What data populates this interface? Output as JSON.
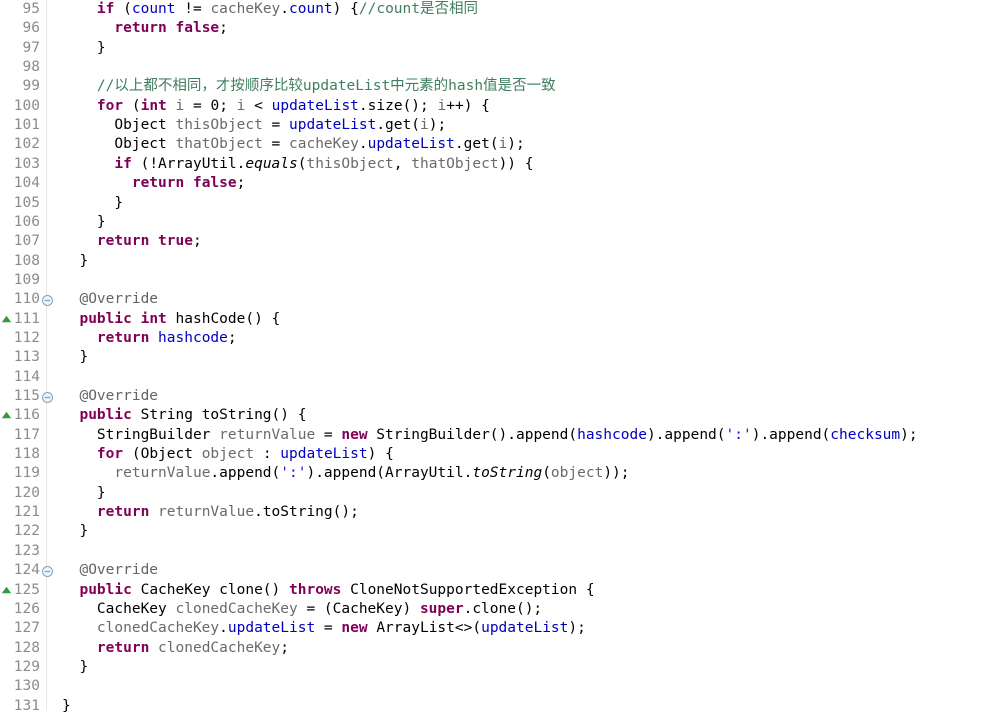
{
  "editor": {
    "language": "java",
    "theme": "eclipse-light",
    "background_color": "#ffffff",
    "gutter_separator_color": "#e8e8e8",
    "line_number_color": "#8c8c8c",
    "first_line": 95,
    "last_line": 131,
    "colors": {
      "keyword": "#7f0055",
      "comment": "#3f7f5f",
      "string": "#2a00ff",
      "field": "#0000c0",
      "annotation": "#646464",
      "local_variable": "#6a6a6a",
      "plain": "#000000",
      "override_marker": "#2e9b3f",
      "fold_icon": "#7aa7c7"
    },
    "icons": {
      "override_marker": "override-triangle-icon",
      "fold_collapse": "fold-collapse-icon"
    }
  },
  "lines": [
    {
      "number": "95",
      "marker": null,
      "fold": false,
      "tokens": [
        {
          "t": "    ",
          "c": "pln"
        },
        {
          "t": "if",
          "c": "kw"
        },
        {
          "t": " (",
          "c": "pln"
        },
        {
          "t": "count",
          "c": "fld"
        },
        {
          "t": " != ",
          "c": "pln"
        },
        {
          "t": "cacheKey",
          "c": "lvar"
        },
        {
          "t": ".",
          "c": "pln"
        },
        {
          "t": "count",
          "c": "fld"
        },
        {
          "t": ") {",
          "c": "pln"
        },
        {
          "t": "//count是否相同",
          "c": "cm"
        }
      ]
    },
    {
      "number": "96",
      "marker": null,
      "fold": false,
      "tokens": [
        {
          "t": "      ",
          "c": "pln"
        },
        {
          "t": "return",
          "c": "kw"
        },
        {
          "t": " ",
          "c": "pln"
        },
        {
          "t": "false",
          "c": "kw"
        },
        {
          "t": ";",
          "c": "pln"
        }
      ]
    },
    {
      "number": "97",
      "marker": null,
      "fold": false,
      "tokens": [
        {
          "t": "    }",
          "c": "pln"
        }
      ]
    },
    {
      "number": "98",
      "marker": null,
      "fold": false,
      "tokens": []
    },
    {
      "number": "99",
      "marker": null,
      "fold": false,
      "tokens": [
        {
          "t": "    ",
          "c": "pln"
        },
        {
          "t": "//以上都不相同，才按顺序比较updateList中元素的hash值是否一致",
          "c": "cm"
        }
      ]
    },
    {
      "number": "100",
      "marker": null,
      "fold": false,
      "tokens": [
        {
          "t": "    ",
          "c": "pln"
        },
        {
          "t": "for",
          "c": "kw"
        },
        {
          "t": " (",
          "c": "pln"
        },
        {
          "t": "int",
          "c": "kw"
        },
        {
          "t": " ",
          "c": "pln"
        },
        {
          "t": "i",
          "c": "lvar"
        },
        {
          "t": " = ",
          "c": "pln"
        },
        {
          "t": "0",
          "c": "num"
        },
        {
          "t": "; ",
          "c": "pln"
        },
        {
          "t": "i",
          "c": "lvar"
        },
        {
          "t": " < ",
          "c": "pln"
        },
        {
          "t": "updateList",
          "c": "fld"
        },
        {
          "t": ".size(); ",
          "c": "pln"
        },
        {
          "t": "i",
          "c": "lvar"
        },
        {
          "t": "++) {",
          "c": "pln"
        }
      ]
    },
    {
      "number": "101",
      "marker": null,
      "fold": false,
      "tokens": [
        {
          "t": "      Object ",
          "c": "pln"
        },
        {
          "t": "thisObject",
          "c": "lvar"
        },
        {
          "t": " = ",
          "c": "pln"
        },
        {
          "t": "updateList",
          "c": "fld"
        },
        {
          "t": ".get(",
          "c": "pln"
        },
        {
          "t": "i",
          "c": "lvar"
        },
        {
          "t": ");",
          "c": "pln"
        }
      ]
    },
    {
      "number": "102",
      "marker": null,
      "fold": false,
      "tokens": [
        {
          "t": "      Object ",
          "c": "pln"
        },
        {
          "t": "thatObject",
          "c": "lvar"
        },
        {
          "t": " = ",
          "c": "pln"
        },
        {
          "t": "cacheKey",
          "c": "lvar"
        },
        {
          "t": ".",
          "c": "pln"
        },
        {
          "t": "updateList",
          "c": "fld"
        },
        {
          "t": ".get(",
          "c": "pln"
        },
        {
          "t": "i",
          "c": "lvar"
        },
        {
          "t": ");",
          "c": "pln"
        }
      ]
    },
    {
      "number": "103",
      "marker": null,
      "fold": false,
      "tokens": [
        {
          "t": "      ",
          "c": "pln"
        },
        {
          "t": "if",
          "c": "kw"
        },
        {
          "t": " (!ArrayUtil.",
          "c": "pln"
        },
        {
          "t": "equals",
          "c": "stat"
        },
        {
          "t": "(",
          "c": "pln"
        },
        {
          "t": "thisObject",
          "c": "lvar"
        },
        {
          "t": ", ",
          "c": "pln"
        },
        {
          "t": "thatObject",
          "c": "lvar"
        },
        {
          "t": ")) {",
          "c": "pln"
        }
      ]
    },
    {
      "number": "104",
      "marker": null,
      "fold": false,
      "tokens": [
        {
          "t": "        ",
          "c": "pln"
        },
        {
          "t": "return",
          "c": "kw"
        },
        {
          "t": " ",
          "c": "pln"
        },
        {
          "t": "false",
          "c": "kw"
        },
        {
          "t": ";",
          "c": "pln"
        }
      ]
    },
    {
      "number": "105",
      "marker": null,
      "fold": false,
      "tokens": [
        {
          "t": "      }",
          "c": "pln"
        }
      ]
    },
    {
      "number": "106",
      "marker": null,
      "fold": false,
      "tokens": [
        {
          "t": "    }",
          "c": "pln"
        }
      ]
    },
    {
      "number": "107",
      "marker": null,
      "fold": false,
      "tokens": [
        {
          "t": "    ",
          "c": "pln"
        },
        {
          "t": "return",
          "c": "kw"
        },
        {
          "t": " ",
          "c": "pln"
        },
        {
          "t": "true",
          "c": "kw"
        },
        {
          "t": ";",
          "c": "pln"
        }
      ]
    },
    {
      "number": "108",
      "marker": null,
      "fold": false,
      "tokens": [
        {
          "t": "  }",
          "c": "pln"
        }
      ]
    },
    {
      "number": "109",
      "marker": null,
      "fold": false,
      "tokens": []
    },
    {
      "number": "110",
      "marker": null,
      "fold": true,
      "tokens": [
        {
          "t": "  ",
          "c": "pln"
        },
        {
          "t": "@Override",
          "c": "ann"
        }
      ]
    },
    {
      "number": "111",
      "marker": "override",
      "fold": false,
      "tokens": [
        {
          "t": "  ",
          "c": "pln"
        },
        {
          "t": "public",
          "c": "kw"
        },
        {
          "t": " ",
          "c": "pln"
        },
        {
          "t": "int",
          "c": "kw"
        },
        {
          "t": " hashCode() {",
          "c": "pln"
        }
      ]
    },
    {
      "number": "112",
      "marker": null,
      "fold": false,
      "tokens": [
        {
          "t": "    ",
          "c": "pln"
        },
        {
          "t": "return",
          "c": "kw"
        },
        {
          "t": " ",
          "c": "pln"
        },
        {
          "t": "hashcode",
          "c": "fld"
        },
        {
          "t": ";",
          "c": "pln"
        }
      ]
    },
    {
      "number": "113",
      "marker": null,
      "fold": false,
      "tokens": [
        {
          "t": "  }",
          "c": "pln"
        }
      ]
    },
    {
      "number": "114",
      "marker": null,
      "fold": false,
      "tokens": []
    },
    {
      "number": "115",
      "marker": null,
      "fold": true,
      "tokens": [
        {
          "t": "  ",
          "c": "pln"
        },
        {
          "t": "@Override",
          "c": "ann"
        }
      ]
    },
    {
      "number": "116",
      "marker": "override",
      "fold": false,
      "tokens": [
        {
          "t": "  ",
          "c": "pln"
        },
        {
          "t": "public",
          "c": "kw"
        },
        {
          "t": " String toString() {",
          "c": "pln"
        }
      ]
    },
    {
      "number": "117",
      "marker": null,
      "fold": false,
      "tokens": [
        {
          "t": "    StringBuilder ",
          "c": "pln"
        },
        {
          "t": "returnValue",
          "c": "lvar"
        },
        {
          "t": " = ",
          "c": "pln"
        },
        {
          "t": "new",
          "c": "kw"
        },
        {
          "t": " StringBuilder().append(",
          "c": "pln"
        },
        {
          "t": "hashcode",
          "c": "fld"
        },
        {
          "t": ").append(",
          "c": "pln"
        },
        {
          "t": "':'",
          "c": "str"
        },
        {
          "t": ").append(",
          "c": "pln"
        },
        {
          "t": "checksum",
          "c": "fld"
        },
        {
          "t": ");",
          "c": "pln"
        }
      ]
    },
    {
      "number": "118",
      "marker": null,
      "fold": false,
      "tokens": [
        {
          "t": "    ",
          "c": "pln"
        },
        {
          "t": "for",
          "c": "kw"
        },
        {
          "t": " (Object ",
          "c": "pln"
        },
        {
          "t": "object",
          "c": "lvar"
        },
        {
          "t": " : ",
          "c": "pln"
        },
        {
          "t": "updateList",
          "c": "fld"
        },
        {
          "t": ") {",
          "c": "pln"
        }
      ]
    },
    {
      "number": "119",
      "marker": null,
      "fold": false,
      "tokens": [
        {
          "t": "      ",
          "c": "pln"
        },
        {
          "t": "returnValue",
          "c": "lvar"
        },
        {
          "t": ".append(",
          "c": "pln"
        },
        {
          "t": "':'",
          "c": "str"
        },
        {
          "t": ").append(ArrayUtil.",
          "c": "pln"
        },
        {
          "t": "toString",
          "c": "stat"
        },
        {
          "t": "(",
          "c": "pln"
        },
        {
          "t": "object",
          "c": "lvar"
        },
        {
          "t": "));",
          "c": "pln"
        }
      ]
    },
    {
      "number": "120",
      "marker": null,
      "fold": false,
      "tokens": [
        {
          "t": "    }",
          "c": "pln"
        }
      ]
    },
    {
      "number": "121",
      "marker": null,
      "fold": false,
      "tokens": [
        {
          "t": "    ",
          "c": "pln"
        },
        {
          "t": "return",
          "c": "kw"
        },
        {
          "t": " ",
          "c": "pln"
        },
        {
          "t": "returnValue",
          "c": "lvar"
        },
        {
          "t": ".toString();",
          "c": "pln"
        }
      ]
    },
    {
      "number": "122",
      "marker": null,
      "fold": false,
      "tokens": [
        {
          "t": "  }",
          "c": "pln"
        }
      ]
    },
    {
      "number": "123",
      "marker": null,
      "fold": false,
      "tokens": []
    },
    {
      "number": "124",
      "marker": null,
      "fold": true,
      "tokens": [
        {
          "t": "  ",
          "c": "pln"
        },
        {
          "t": "@Override",
          "c": "ann"
        }
      ]
    },
    {
      "number": "125",
      "marker": "override",
      "fold": false,
      "tokens": [
        {
          "t": "  ",
          "c": "pln"
        },
        {
          "t": "public",
          "c": "kw"
        },
        {
          "t": " CacheKey clone() ",
          "c": "pln"
        },
        {
          "t": "throws",
          "c": "kw"
        },
        {
          "t": " CloneNotSupportedException {",
          "c": "pln"
        }
      ]
    },
    {
      "number": "126",
      "marker": null,
      "fold": false,
      "tokens": [
        {
          "t": "    CacheKey ",
          "c": "pln"
        },
        {
          "t": "clonedCacheKey",
          "c": "lvar"
        },
        {
          "t": " = (CacheKey) ",
          "c": "pln"
        },
        {
          "t": "super",
          "c": "kw"
        },
        {
          "t": ".clone();",
          "c": "pln"
        }
      ]
    },
    {
      "number": "127",
      "marker": null,
      "fold": false,
      "tokens": [
        {
          "t": "    ",
          "c": "pln"
        },
        {
          "t": "clonedCacheKey",
          "c": "lvar"
        },
        {
          "t": ".",
          "c": "pln"
        },
        {
          "t": "updateList",
          "c": "fld"
        },
        {
          "t": " = ",
          "c": "pln"
        },
        {
          "t": "new",
          "c": "kw"
        },
        {
          "t": " ArrayList<>(",
          "c": "pln"
        },
        {
          "t": "updateList",
          "c": "fld"
        },
        {
          "t": ");",
          "c": "pln"
        }
      ]
    },
    {
      "number": "128",
      "marker": null,
      "fold": false,
      "tokens": [
        {
          "t": "    ",
          "c": "pln"
        },
        {
          "t": "return",
          "c": "kw"
        },
        {
          "t": " ",
          "c": "pln"
        },
        {
          "t": "clonedCacheKey",
          "c": "lvar"
        },
        {
          "t": ";",
          "c": "pln"
        }
      ]
    },
    {
      "number": "129",
      "marker": null,
      "fold": false,
      "tokens": [
        {
          "t": "  }",
          "c": "pln"
        }
      ]
    },
    {
      "number": "130",
      "marker": null,
      "fold": false,
      "tokens": []
    },
    {
      "number": "131",
      "marker": null,
      "fold": false,
      "tokens": [
        {
          "t": "}",
          "c": "pln"
        }
      ]
    }
  ]
}
